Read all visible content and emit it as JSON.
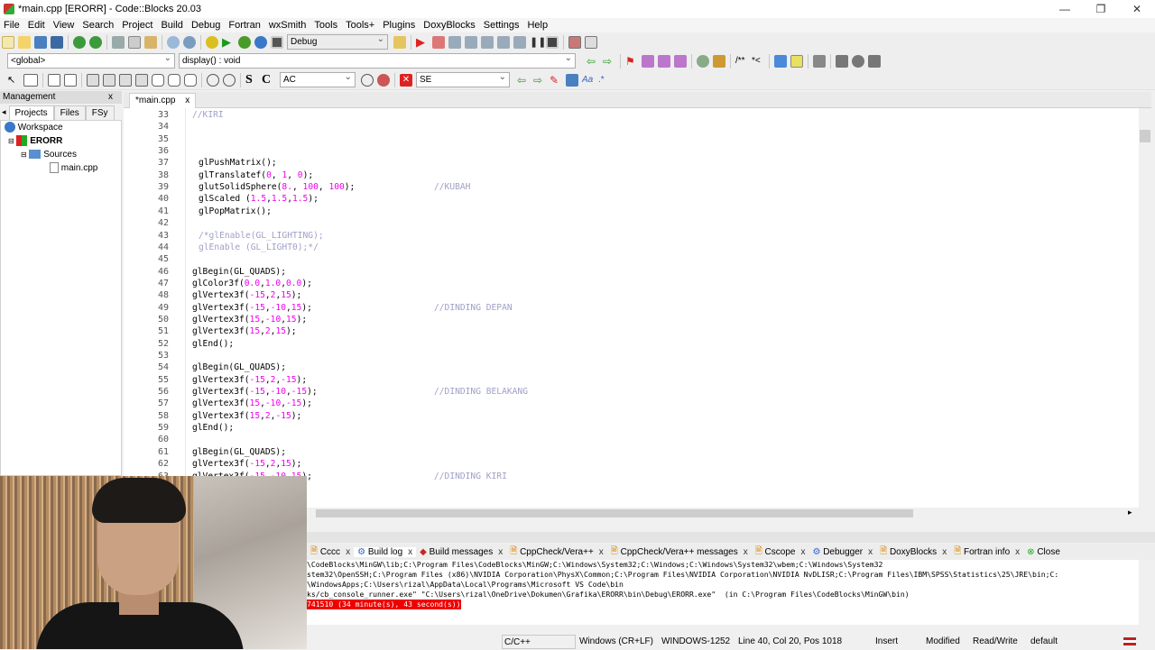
{
  "window": {
    "title": "*main.cpp [ERORR] - Code::Blocks 20.03",
    "minimize": "—",
    "maximize": "❐",
    "close": "✕"
  },
  "menu": [
    "File",
    "Edit",
    "View",
    "Search",
    "Project",
    "Build",
    "Debug",
    "Fortran",
    "wxSmith",
    "Tools",
    "Tools+",
    "Plugins",
    "DoxyBlocks",
    "Settings",
    "Help"
  ],
  "toolbar": {
    "build_target": "Debug",
    "scope": "<global>",
    "function": "display() : void",
    "search_text": "AC",
    "regex_text": "SE",
    "bold_s": "S",
    "bold_c": "C"
  },
  "management": {
    "title": "Management",
    "close": "x",
    "tabs": [
      "Projects",
      "Files",
      "FSy"
    ],
    "tree": {
      "workspace": "Workspace",
      "project": "ERORR",
      "folder": "Sources",
      "file": "main.cpp"
    }
  },
  "editor": {
    "tab_label": "*main.cpp",
    "tab_close": "x",
    "lines": [
      {
        "n": "33",
        "code": "//KIRI",
        "cls": "cm",
        "indent": 0
      },
      {
        "n": "34",
        "code": "",
        "indent": 0
      },
      {
        "n": "35",
        "code": "",
        "indent": 0
      },
      {
        "n": "36",
        "code": "",
        "indent": 0
      },
      {
        "n": "37",
        "code": "glPushMatrix();",
        "indent": 1
      },
      {
        "n": "38",
        "code": "glTranslatef(0, 1, 0);",
        "indent": 1
      },
      {
        "n": "39",
        "code": "glutSolidSphere(8., 100, 100);",
        "indent": 1,
        "comment": "//KUBAH"
      },
      {
        "n": "40",
        "code": "glScaled (1.5,1.5,1.5);",
        "indent": 1
      },
      {
        "n": "41",
        "code": "glPopMatrix();",
        "indent": 1
      },
      {
        "n": "42",
        "code": "",
        "indent": 0
      },
      {
        "n": "43",
        "code": "/*glEnable(GL_LIGHTING);",
        "cls": "cm",
        "indent": 1
      },
      {
        "n": "44",
        "code": "glEnable (GL_LIGHT0);*/",
        "cls": "cm",
        "indent": 1
      },
      {
        "n": "45",
        "code": "",
        "indent": 0
      },
      {
        "n": "46",
        "code": "glBegin(GL_QUADS);",
        "indent": 0
      },
      {
        "n": "47",
        "code": "glColor3f(0.0,1.0,0.0);",
        "indent": 0
      },
      {
        "n": "48",
        "code": "glVertex3f(-15,2,15);",
        "indent": 0
      },
      {
        "n": "49",
        "code": "glVertex3f(-15,-10,15);",
        "indent": 0,
        "comment": "//DINDING DEPAN"
      },
      {
        "n": "50",
        "code": "glVertex3f(15,-10,15);",
        "indent": 0
      },
      {
        "n": "51",
        "code": "glVertex3f(15,2,15);",
        "indent": 0
      },
      {
        "n": "52",
        "code": "glEnd();",
        "indent": 0
      },
      {
        "n": "53",
        "code": "",
        "indent": 0
      },
      {
        "n": "54",
        "code": "glBegin(GL_QUADS);",
        "indent": 0
      },
      {
        "n": "55",
        "code": "glVertex3f(-15,2,-15);",
        "indent": 0
      },
      {
        "n": "56",
        "code": "glVertex3f(-15,-10,-15);",
        "indent": 0,
        "comment": "//DINDING BELAKANG"
      },
      {
        "n": "57",
        "code": "glVertex3f(15,-10,-15);",
        "indent": 0
      },
      {
        "n": "58",
        "code": "glVertex3f(15,2,-15);",
        "indent": 0
      },
      {
        "n": "59",
        "code": "glEnd();",
        "indent": 0
      },
      {
        "n": "60",
        "code": "",
        "indent": 0
      },
      {
        "n": "61",
        "code": "glBegin(GL_QUADS);",
        "indent": 0
      },
      {
        "n": "62",
        "code": "glVertex3f(-15,2,15);",
        "indent": 0
      },
      {
        "n": "63",
        "code": "glVertex3f(-15,-10,15);",
        "indent": 0,
        "comment": "//DINDING KIRI"
      }
    ]
  },
  "logs": {
    "tabs": [
      "Cccc",
      "Build log",
      "Build messages",
      "CppCheck/Vera++",
      "CppCheck/Vera++ messages",
      "Cscope",
      "Debugger",
      "DoxyBlocks",
      "Fortran info",
      "Close"
    ],
    "active_tab": "Build log",
    "lines": [
      "\\CodeBlocks\\MinGW\\lib;C:\\Program Files\\CodeBlocks\\MinGW;C:\\Windows\\System32;C:\\Windows;C:\\Windows\\System32\\wbem;C:\\Windows\\System32",
      "stem32\\OpenSSH;C:\\Program Files (x86)\\NVIDIA Corporation\\PhysX\\Common;C:\\Program Files\\NVIDIA Corporation\\NVIDIA NvDLISR;C:\\Program Files\\IBM\\SPSS\\Statistics\\25\\JRE\\bin;C:",
      "\\WindowsApps;C:\\Users\\rizal\\AppData\\Local\\Programs\\Microsoft VS Code\\bin",
      "ks/cb_console_runner.exe\" \"C:\\Users\\rizal\\OneDrive\\Dokumen\\Grafika\\ERORR\\bin\\Debug\\ERORR.exe\"  (in C:\\Program Files\\CodeBlocks\\MinGW\\bin)"
    ],
    "error_line": "741510 (34 minute(s), 43 second(s))"
  },
  "status": {
    "lang": "C/C++",
    "eol": "Windows (CR+LF)",
    "encoding": "WINDOWS-1252",
    "position": "Line 40, Col 20, Pos 1018",
    "mode": "Insert",
    "modified": "Modified",
    "rw": "Read/Write",
    "profile": "default"
  }
}
